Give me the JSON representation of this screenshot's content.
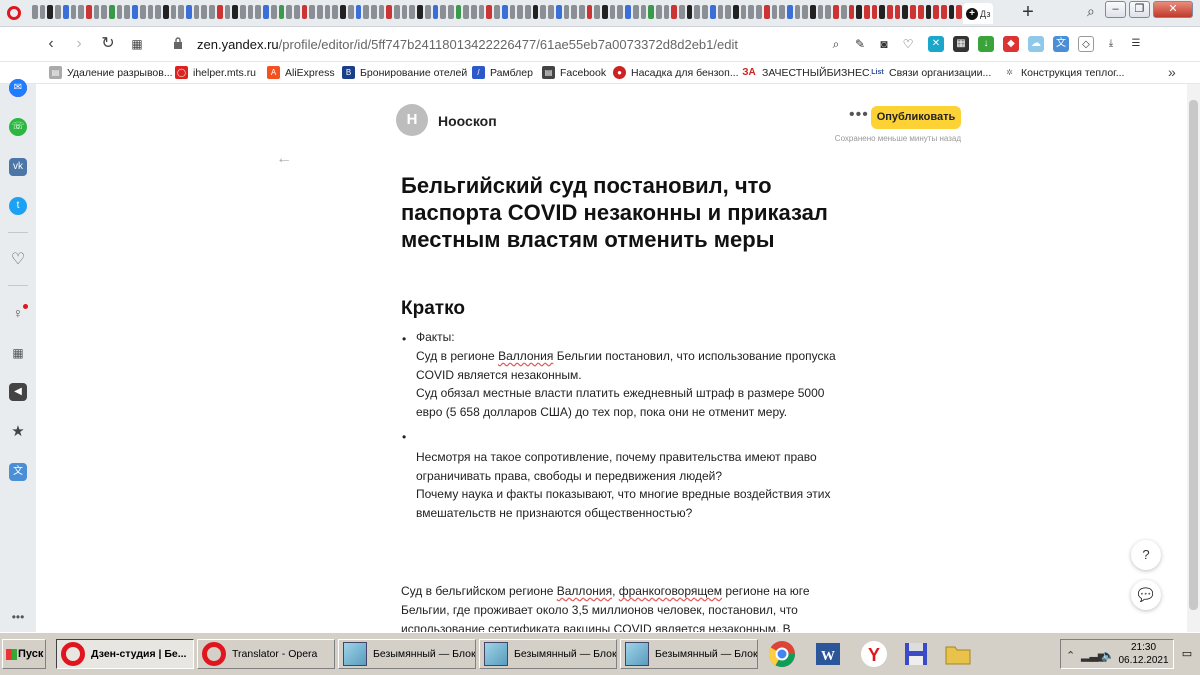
{
  "browser": {
    "active_tab_label": "Дз",
    "url_host": "zen.yandex.ru",
    "url_path": "/profile/editor/id/5ff747b24118013422226477/61ae55eb7a0073372d8d2eb1/edit"
  },
  "bookmarks": [
    {
      "label": "Удаление разрывов..."
    },
    {
      "label": "ihelper.mts.ru"
    },
    {
      "label": "AliExpress"
    },
    {
      "label": "Бронирование отелей"
    },
    {
      "label": "Рамблер"
    },
    {
      "label": "Facebook"
    },
    {
      "label": "Насадка для бензоп..."
    },
    {
      "label": "ЗАЧЕСТНЫЙБИЗНЕС..."
    },
    {
      "label": "Связи организации..."
    },
    {
      "label": "Конструкция теплог..."
    }
  ],
  "editor": {
    "avatar_letter": "Н",
    "channel_name": "Нооскоп",
    "publish_label": "Опубликовать",
    "saved_status": "Сохранено меньше минуты назад",
    "title": "Бельгийский суд постановил, что паспорта COVID незаконны и приказал местным властям отменить меры",
    "subtitle": "Кратко",
    "facts_heading": "Факты:",
    "fact1_a": "Суд в регионе ",
    "fact1_b": "Валлония",
    "fact1_c": " Бельгии постановил, что использование пропуска COVID является незаконным.",
    "fact2": "Суд обязал местные власти платить ежедневный штраф в размере 5000 евро (5 658 долларов США) до тех пор, пока они не отменит меру.",
    "question1": "Несмотря на такое сопротивление, почему правительства имеют право ограничивать права, свободы и передвижения людей?",
    "question2": "Почему наука и факты показывают, что многие вредные воздействия этих вмешательств не признаются общественностью?",
    "para_a": "Суд в бельгийском регионе ",
    "para_b": "Валлония",
    "para_c": ", ",
    "para_d": "франкоговорящем",
    "para_e": " регионе на юге Бельгии, где проживает около 3,5 миллионов человек, постановил, что использование сертификата вакцины COVID является незаконным. В",
    "help_label": "?"
  },
  "taskbar": {
    "start_label": "Пуск",
    "tasks": [
      {
        "label": "Дзен-студия | Бе..."
      },
      {
        "label": "Translator - Opera"
      },
      {
        "label": "Безымянный — Блок..."
      },
      {
        "label": "Безымянный — Блок..."
      },
      {
        "label": "Безымянный — Блок..."
      }
    ],
    "time": "21:30",
    "date": "06.12.2021"
  }
}
